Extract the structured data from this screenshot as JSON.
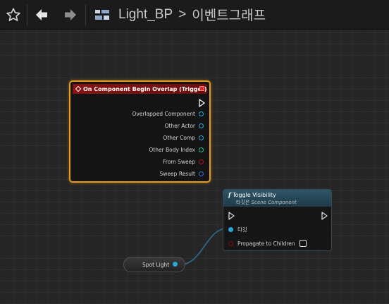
{
  "toolbar": {
    "breadcrumb_root": "Light_BP",
    "breadcrumb_separator": ">",
    "breadcrumb_current": "이벤트그래프"
  },
  "event_node": {
    "title": "On Component Begin Overlap (Trigger)",
    "pins": [
      {
        "label": "Overlapped Component",
        "color": "#2aa7d8"
      },
      {
        "label": "Other Actor",
        "color": "#2aa7d8"
      },
      {
        "label": "Other Comp",
        "color": "#2aa7d8"
      },
      {
        "label": "Other Body Index",
        "color": "#22c48a"
      },
      {
        "label": "From Sweep",
        "color": "#b01414"
      },
      {
        "label": "Sweep Result",
        "color": "#2e6fd0"
      }
    ],
    "header_color": "#8a1313",
    "border_color": "#e59b1c"
  },
  "function_node": {
    "title": "Toggle Visibility",
    "subtitle_prefix": "타깃은",
    "subtitle_class": "Scene Component",
    "target_label": "타깃",
    "propagate_label": "Propagate to Children",
    "header_color": "#2f5568"
  },
  "variable_node": {
    "label": "Spot Light",
    "pin_color": "#2aa7d8"
  },
  "icons": {
    "favorite": "star-icon",
    "back": "arrow-left-icon",
    "forward": "arrow-right-icon",
    "graph": "event-graph-icon"
  }
}
